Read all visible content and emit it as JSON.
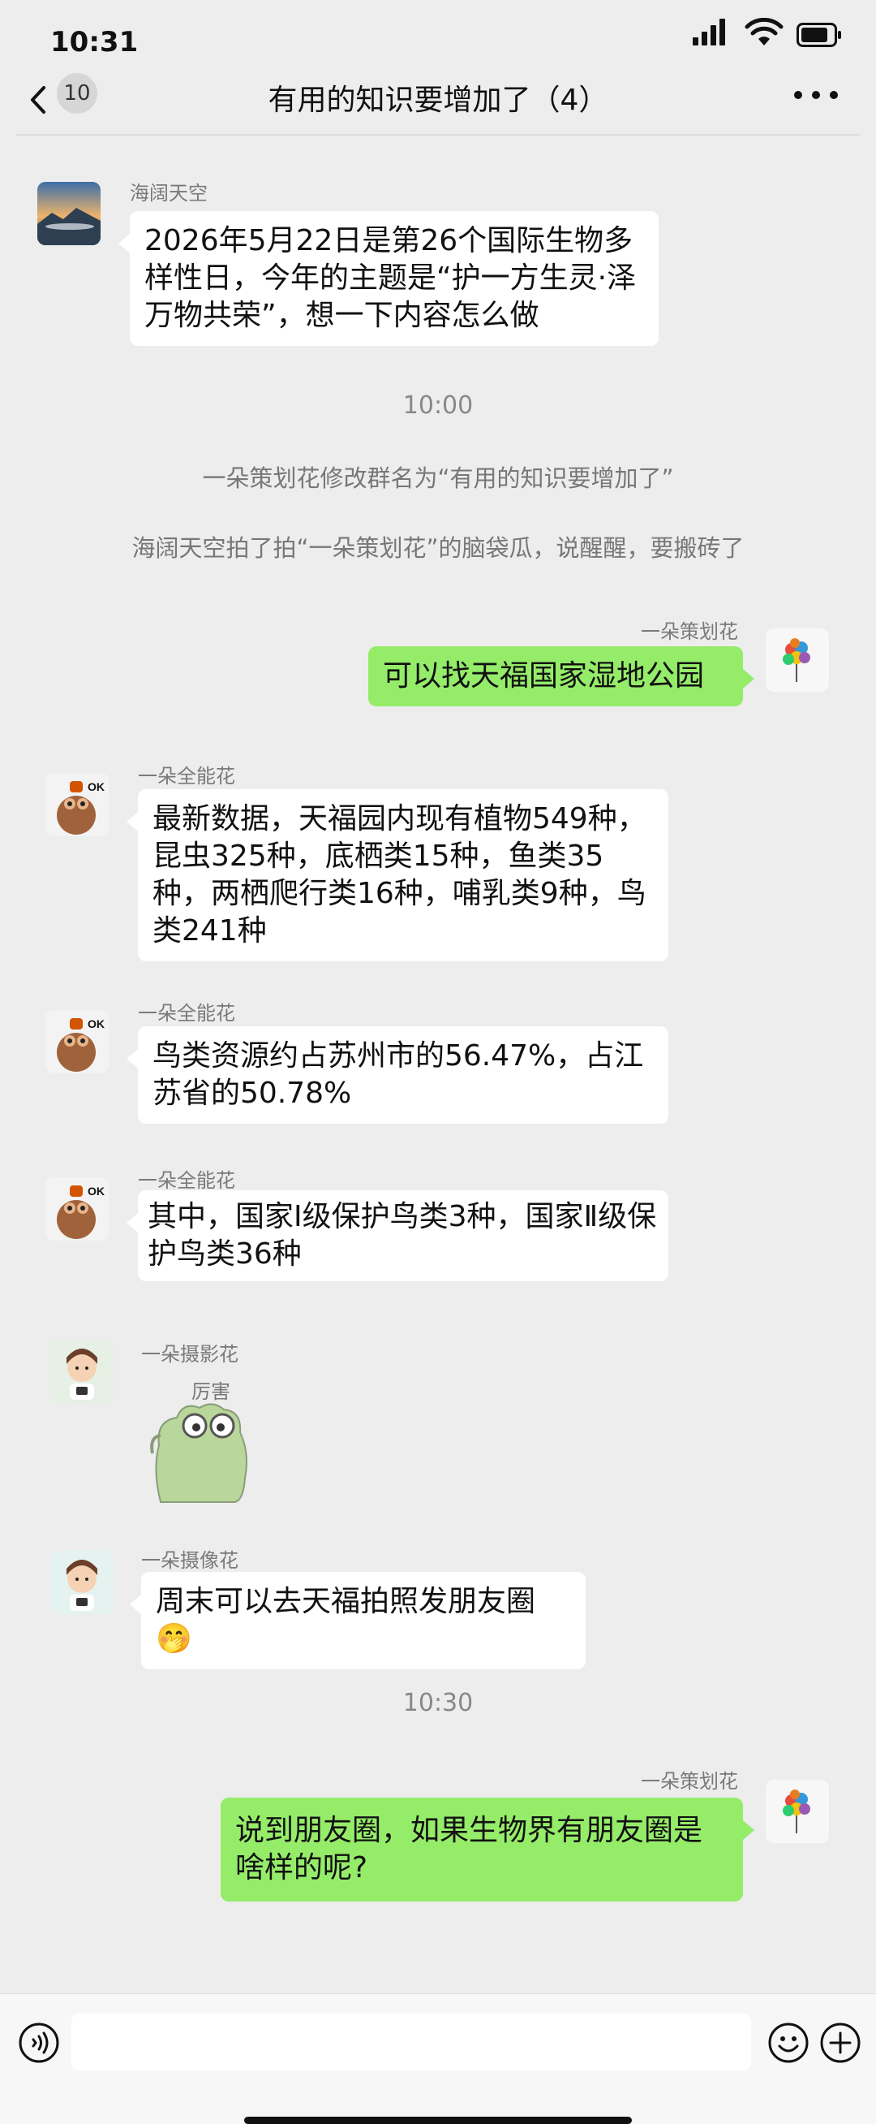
{
  "status": {
    "time": "10:31"
  },
  "header": {
    "back_count": "10",
    "title": "有用的知识要增加了（4）"
  },
  "messages": [
    {
      "sender": "海阔天空",
      "text": "2026年5月22日是第26个国际生物多样性日，今年的主题是“护一方生灵·泽万物共荣”，想一下内容怎么做"
    },
    {
      "sender": "一朵策划花",
      "text": "可以找天福国家湿地公园"
    },
    {
      "sender": "一朵全能花",
      "text": "最新数据，天福园内现有植物549种，昆虫325种，底栖类15种，鱼类35种，两栖爬行类16种，哺乳类9种，鸟类241种"
    },
    {
      "sender": "一朵全能花",
      "text": "鸟类资源约占苏州市的56.47%，占江苏省的50.78%"
    },
    {
      "sender": "一朵全能花",
      "text": "其中，国家Ⅰ级保护鸟类3种，国家Ⅱ级保护鸟类36种"
    },
    {
      "sender": "一朵摄影花",
      "sticker_text": "厉害"
    },
    {
      "sender": "一朵摄像花",
      "text": "周末可以去天福拍照发朋友圈🤭"
    },
    {
      "sender": "一朵策划花",
      "text": "说到朋友圈，如果生物界有朋友圈是啥样的呢?"
    }
  ],
  "timestamps": [
    "10:00",
    "10:30"
  ],
  "system": [
    "一朵策划花修改群名为“有用的知识要增加了”",
    "海阔天空拍了拍“一朵策划花”的脑袋瓜，说醒醒，要搬砖了"
  ],
  "icons": {
    "back": "chevron-left-icon",
    "more": "more-dots-icon",
    "voice": "voice-icon",
    "emoji": "emoji-icon",
    "plus": "plus-icon"
  },
  "colors": {
    "self_bubble": "#95ec69",
    "other_bubble": "#ffffff",
    "background": "#ededed"
  }
}
